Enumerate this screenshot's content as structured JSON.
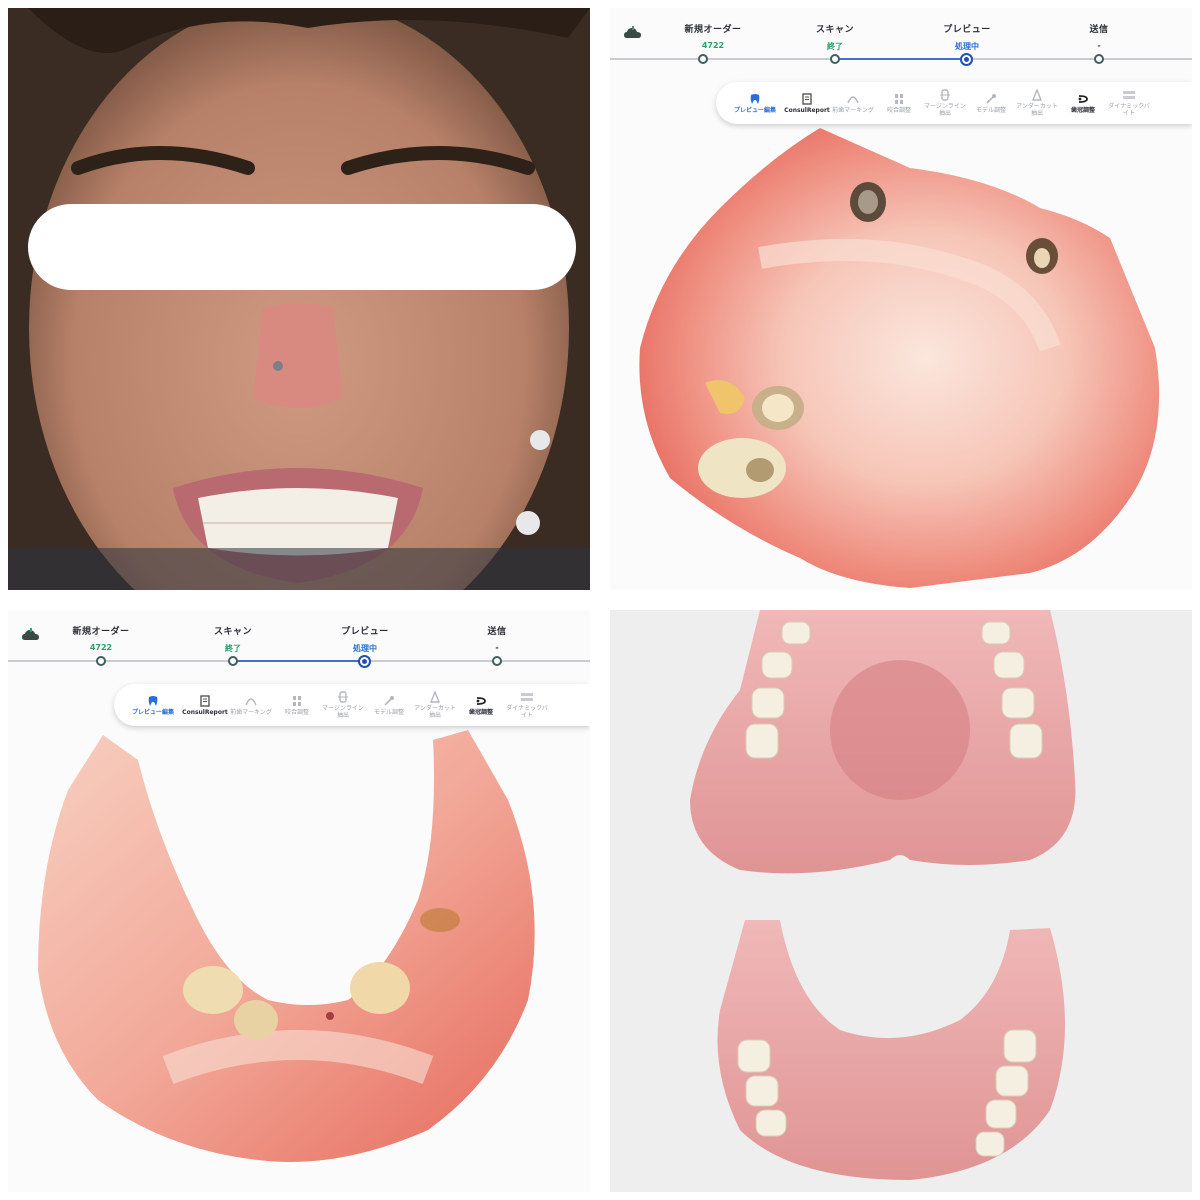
{
  "scanner": {
    "steps": [
      {
        "label": "新規オーダー",
        "value": "4722",
        "tone": "green"
      },
      {
        "label": "スキャン",
        "value": "終了",
        "tone": "green"
      },
      {
        "label": "プレビュー",
        "value": "処理中",
        "tone": "blue"
      },
      {
        "label": "送信",
        "value": "-",
        "tone": "gray"
      }
    ],
    "tools": [
      {
        "label": "プレビュー編集",
        "icon": "tooth-icon"
      },
      {
        "label": "ConsulReport",
        "icon": "report-icon"
      },
      {
        "label": "前歯マーキング",
        "icon": "arch-icon"
      },
      {
        "label": "咬合調整",
        "icon": "occlusion-icon"
      },
      {
        "label": "マージンライン抽出",
        "icon": "margin-line-icon"
      },
      {
        "label": "モデル調整",
        "icon": "model-icon"
      },
      {
        "label": "アンダーカット抽出",
        "icon": "undercut-icon"
      },
      {
        "label": "歯冠調整",
        "icon": "crown-icon"
      },
      {
        "label": "ダイナミックバイト",
        "icon": "dynamic-bite-icon"
      }
    ]
  },
  "colors": {
    "accent": "#2a6fd8",
    "done": "#24a36b",
    "gum": "#e8766a",
    "gum_light": "#f4b3a6",
    "denture_pink": "#e9a6a6"
  }
}
